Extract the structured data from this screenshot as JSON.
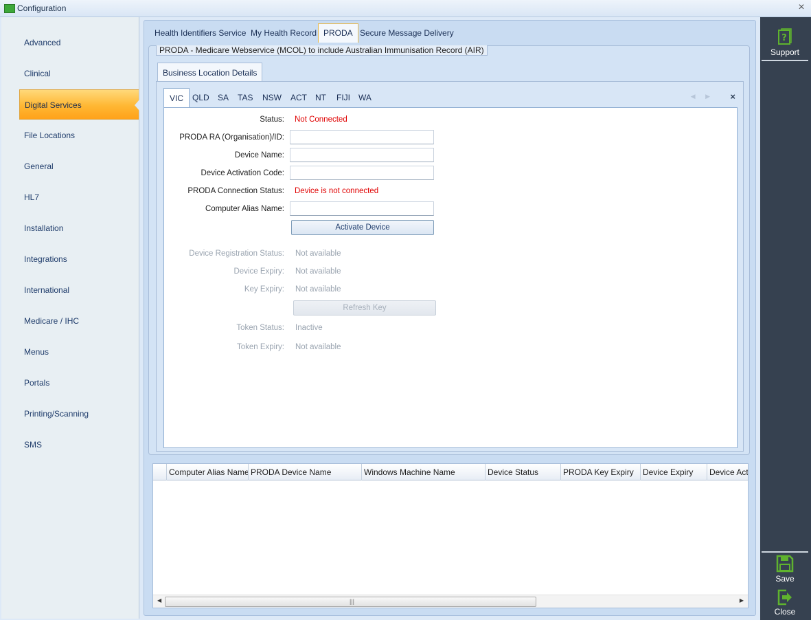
{
  "window": {
    "title": "Configuration",
    "close": "×"
  },
  "nav": {
    "items": [
      {
        "label": "Advanced"
      },
      {
        "label": "Clinical"
      },
      {
        "label": "Digital Services"
      },
      {
        "label": "File Locations"
      },
      {
        "label": "General"
      },
      {
        "label": "HL7"
      },
      {
        "label": "Installation"
      },
      {
        "label": "Integrations"
      },
      {
        "label": "International"
      },
      {
        "label": "Medicare / IHC"
      },
      {
        "label": "Menus"
      },
      {
        "label": "Portals"
      },
      {
        "label": "Printing/Scanning"
      },
      {
        "label": "SMS"
      }
    ],
    "active": "Digital Services"
  },
  "tabs": {
    "items": [
      "Health Identifiers Service",
      "My Health Record",
      "PRODA",
      "Secure Message Delivery"
    ],
    "active": "PRODA"
  },
  "group": {
    "title": "PRODA - Medicare Webservice (MCOL) to include Australian Immunisation Record (AIR)",
    "inner_tab": "Business Location Details"
  },
  "states": {
    "items": [
      "VIC",
      "QLD",
      "SA",
      "TAS",
      "NSW",
      "ACT",
      "NT",
      "FIJI",
      "WA"
    ],
    "active": "VIC",
    "close": "×",
    "nav_glyphs": "◀ ▶"
  },
  "form": {
    "status_label": "Status:",
    "status_value": "Not Connected",
    "ra_label": "PRODA RA (Organisation)/ID:",
    "ra_value": "",
    "device_name_label": "Device Name:",
    "device_name_value": "",
    "activation_label": "Device Activation Code:",
    "activation_value": "",
    "conn_label": "PRODA Connection Status:",
    "conn_value": "Device is not connected",
    "alias_label": "Computer Alias Name:",
    "alias_value": "",
    "activate_button": "Activate Device",
    "reg_status_label": "Device Registration Status:",
    "reg_status_value": "Not available",
    "device_expiry_label": "Device Expiry:",
    "device_expiry_value": "Not available",
    "key_expiry_label": "Key Expiry:",
    "key_expiry_value": "Not available",
    "refresh_button": "Refresh Key",
    "token_status_label": "Token Status:",
    "token_status_value": "Inactive",
    "token_expiry_label": "Token Expiry:",
    "token_expiry_value": "Not available"
  },
  "grid": {
    "columns": [
      "Computer Alias Name",
      "PRODA Device Name",
      "Windows Machine Name",
      "Device Status",
      "PRODA Key Expiry",
      "Device Expiry",
      "Device Acti"
    ],
    "rows": [],
    "scroll_left": "◀",
    "scroll_right": "▶",
    "scroll_grip": "|||"
  },
  "rightbar": {
    "support_label": "Support",
    "save_label": "Save",
    "close_label": "Close"
  },
  "colors": {
    "accent_orange": "#ffb733",
    "error_red": "#e00000",
    "icon_green": "#5fb32e",
    "sidebar_dark": "#364150"
  }
}
